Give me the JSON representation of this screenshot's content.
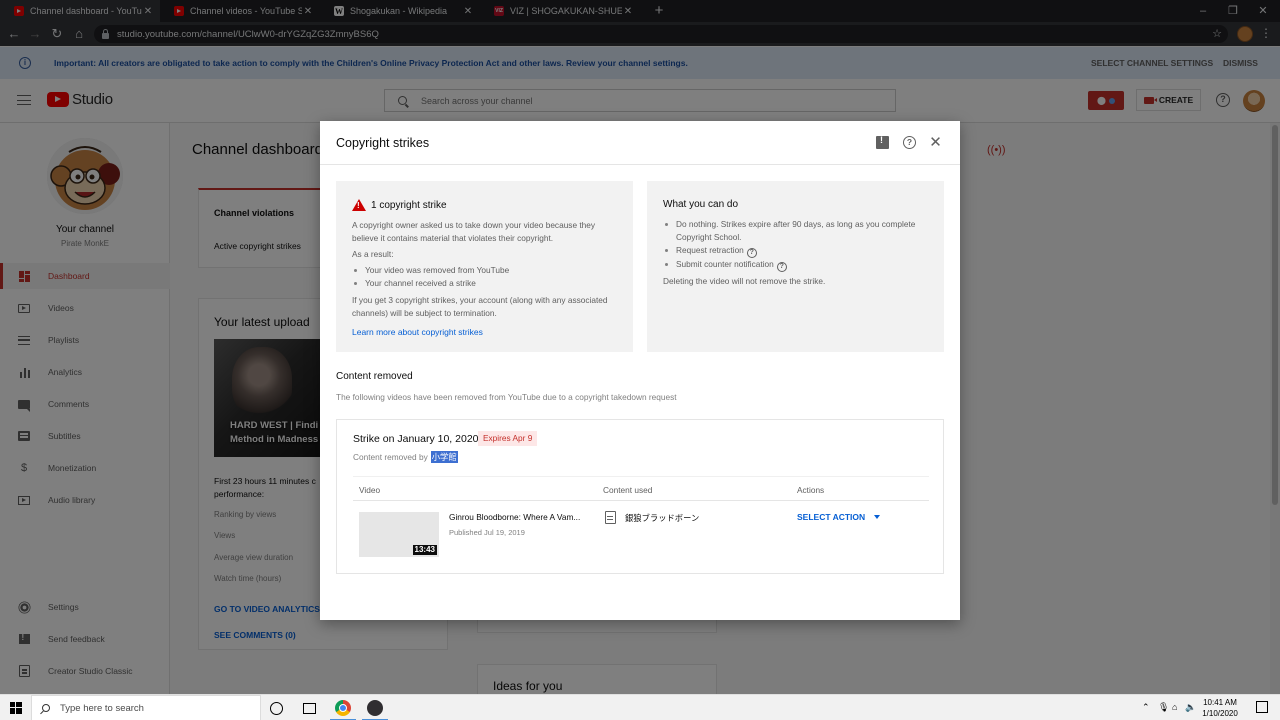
{
  "browser": {
    "tabs": [
      {
        "title": "Channel dashboard - YouTube Studio",
        "icon": "youtube-icon",
        "active": true
      },
      {
        "title": "Channel videos - YouTube Studio",
        "icon": "youtube-icon",
        "active": false
      },
      {
        "title": "Shogakukan - Wikipedia",
        "icon": "wikipedia-icon",
        "active": false
      },
      {
        "title": "VIZ | SHOGAKUKAN-SHUEISHA P",
        "icon": "viz-icon",
        "active": false
      }
    ],
    "url": "studio.youtube.com/channel/UClwW0-drYGZqZG3ZmnyBS6Q"
  },
  "banner": {
    "text": "Important: All creators are obligated to take action to comply with the Children's Online Privacy Protection Act and other laws. Review your channel settings.",
    "settings_label": "SELECT CHANNEL SETTINGS",
    "dismiss_label": "DISMISS"
  },
  "header": {
    "logo_text": "Studio",
    "search_placeholder": "Search across your channel",
    "create_label": "CREATE"
  },
  "sidebar": {
    "channel_label": "Your channel",
    "channel_name": "Pirate MonkE",
    "items": [
      {
        "label": "Dashboard",
        "icon": "dashboard-icon",
        "active": true
      },
      {
        "label": "Videos",
        "icon": "videos-icon"
      },
      {
        "label": "Playlists",
        "icon": "playlists-icon"
      },
      {
        "label": "Analytics",
        "icon": "analytics-icon"
      },
      {
        "label": "Comments",
        "icon": "comments-icon"
      },
      {
        "label": "Subtitles",
        "icon": "subtitles-icon"
      },
      {
        "label": "Monetization",
        "icon": "dollar-icon"
      },
      {
        "label": "Audio library",
        "icon": "audio-library-icon"
      }
    ],
    "bottom_items": [
      {
        "label": "Settings",
        "icon": "gear-icon"
      },
      {
        "label": "Send feedback",
        "icon": "feedback-icon"
      },
      {
        "label": "Creator Studio Classic",
        "icon": "classic-studio-icon"
      }
    ]
  },
  "main": {
    "title": "Channel dashboard",
    "violations": {
      "title": "Channel violations",
      "row": "Active copyright strikes"
    },
    "latest_upload": {
      "title": "Your latest upload",
      "thumb_text_1": "HARD WEST | Findi",
      "thumb_text_2": "Method in Madness",
      "meta": "First 23 hours 11 minutes c performance:",
      "stats": [
        "Ranking by views",
        "Views",
        "Average view duration",
        "Watch time (hours)"
      ],
      "analytics_link": "GO TO VIDEO ANALYTICS",
      "comments_link": "SEE COMMENTS (0)"
    },
    "ideas_title": "Ideas for you"
  },
  "modal": {
    "title": "Copyright strikes",
    "left_panel": {
      "heading": "1 copyright strike",
      "intro": "A copyright owner asked us to take down your video because they believe it contains material that violates their copyright.",
      "result_label": "As a result:",
      "results": [
        "Your video was removed from YouTube",
        "Your channel received a strike"
      ],
      "warning": "If you get 3 copyright strikes, your account (along with any associated channels) will be subject to termination.",
      "link": "Learn more about copyright strikes"
    },
    "right_panel": {
      "heading": "What you can do",
      "options": [
        "Do nothing. Strikes expire after 90 days, as long as you complete Copyright School.",
        "Request retraction",
        "Submit counter notification"
      ],
      "note": "Deleting the video will not remove the strike."
    },
    "content_removed": {
      "title": "Content removed",
      "subtitle": "The following videos have been removed from YouTube due to a copyright takedown request"
    },
    "strike": {
      "date": "Strike on January 10, 2020",
      "expires": "Expires Apr 9",
      "removed_by_label": "Content removed by",
      "claimant": "小学館",
      "columns": [
        "Video",
        "Content used",
        "Actions"
      ],
      "video_title": "Ginrou Bloodborne: Where A Vam...",
      "video_published": "Published Jul 19, 2019",
      "video_duration": "13:43",
      "content_used": "銀狼ブラッドボーン",
      "action_label": "SELECT ACTION"
    }
  },
  "taskbar": {
    "search_placeholder": "Type here to search",
    "time": "10:41 AM",
    "date": "1/10/2020"
  }
}
